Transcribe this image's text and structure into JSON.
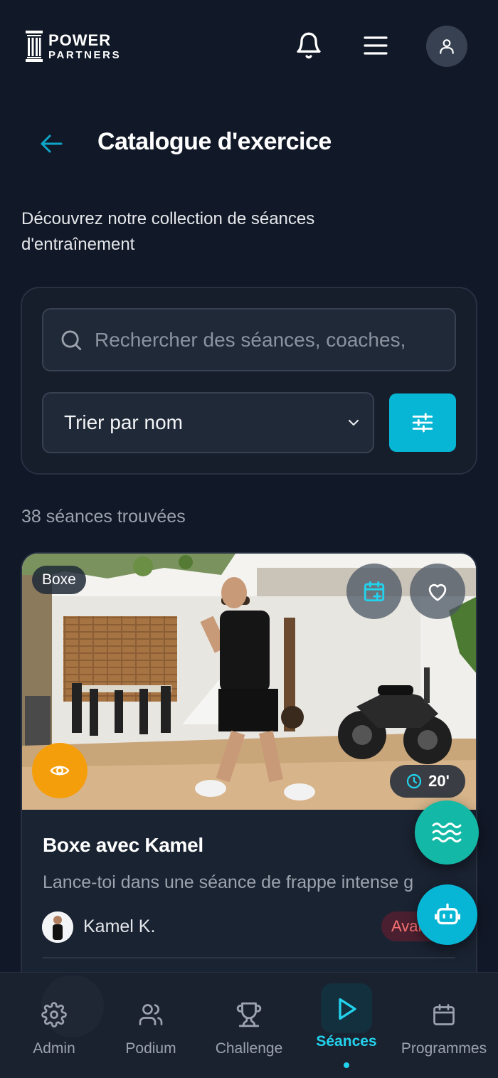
{
  "header": {
    "logo_line1": "POWER",
    "logo_line2": "PARTNERS",
    "icons": [
      "bell-icon",
      "menu-icon",
      "user-icon"
    ]
  },
  "page": {
    "title": "Catalogue d'exercice",
    "subtitle": "Découvrez notre collection de séances d'entraînement"
  },
  "filters": {
    "search_placeholder": "Rechercher des séances, coaches,",
    "sort_label": "Trier par nom"
  },
  "results": {
    "count_text": "38 séances trouvées"
  },
  "card": {
    "category": "Boxe",
    "duration": "20'",
    "title": "Boxe avec Kamel",
    "description": "Lance-toi dans une séance de frappe intense g",
    "coach": "Kamel K.",
    "level": "Avancé"
  },
  "nav": {
    "items": [
      {
        "label": "Admin",
        "icon": "gear-icon"
      },
      {
        "label": "Podium",
        "icon": "users-icon"
      },
      {
        "label": "Challenge",
        "icon": "trophy-icon"
      },
      {
        "label": "Séances",
        "icon": "play-icon",
        "active": true
      },
      {
        "label": "Programmes",
        "icon": "calendar-icon"
      }
    ]
  },
  "colors": {
    "background": "#111827",
    "accent": "#06b6d4",
    "eye_button": "#f59e0b",
    "wave_button": "#14b8a6"
  }
}
